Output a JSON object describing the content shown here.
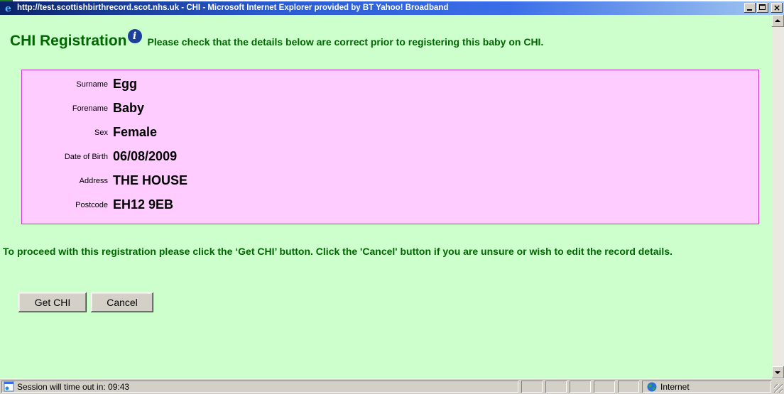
{
  "window": {
    "title": "http://test.scottishbirthrecord.scot.nhs.uk - CHI - Microsoft Internet Explorer provided by BT Yahoo! Broadband",
    "controls": {
      "minimize": "_",
      "maximize": "□",
      "close": "×"
    }
  },
  "page": {
    "heading": "CHI Registration",
    "info_icon": "i",
    "instruction": "Please check that the details below are correct prior to registering this baby on CHI.",
    "details": [
      {
        "label": "Surname",
        "value": "Egg"
      },
      {
        "label": "Forename",
        "value": "Baby"
      },
      {
        "label": "Sex",
        "value": "Female"
      },
      {
        "label": "Date of Birth",
        "value": "06/08/2009"
      },
      {
        "label": "Address",
        "value": "THE HOUSE"
      },
      {
        "label": "Postcode",
        "value": "EH12 9EB"
      }
    ],
    "proceed_text": "To proceed with this registration please click the ‘Get CHI’ button. Click the 'Cancel' button if you are unsure or wish to edit the record details.",
    "buttons": {
      "get_chi": "Get CHI",
      "cancel": "Cancel"
    }
  },
  "status_bar": {
    "session_text": "Session will time out in:  09:43",
    "zone_text": "Internet"
  },
  "colors": {
    "page_background": "#ccffcc",
    "details_background": "#ffccff",
    "details_border": "#cc33cc",
    "text_green": "#006600",
    "info_icon_blue": "#1b3f9a"
  },
  "icons": [
    "ie-logo-icon",
    "info-icon",
    "page-icon",
    "globe-icon"
  ]
}
